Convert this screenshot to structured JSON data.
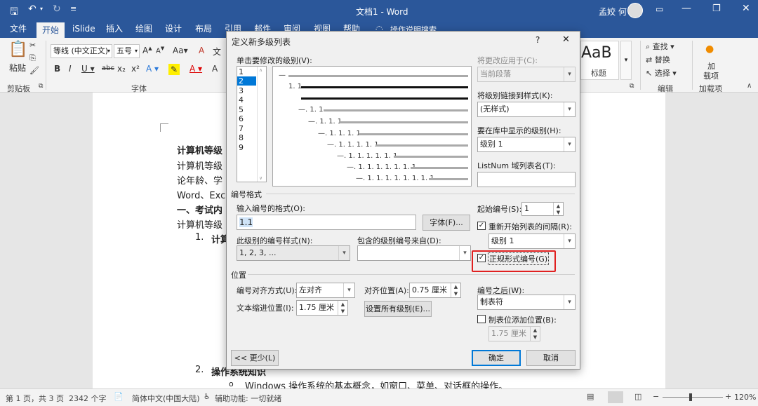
{
  "window": {
    "doc_title": "文档1 - Word",
    "user": "孟姣 何"
  },
  "tabs": [
    "文件",
    "开始",
    "iSlide",
    "插入",
    "绘图",
    "设计",
    "布局",
    "引用",
    "邮件",
    "审阅",
    "视图",
    "帮助"
  ],
  "tellme": "操作说明搜索",
  "ribbon": {
    "paste": "粘贴",
    "clipboard_group": "剪贴板",
    "font_name": "等线 (中文正文)",
    "font_size": "五号",
    "font_group": "字体",
    "style_sample": "AaB",
    "style_name": "标题",
    "find": "查找",
    "replace": "替换",
    "select": "选择",
    "edit_group": "编辑",
    "addin_label_1": "加",
    "addin_label_2": "载项",
    "addin_group": "加载项"
  },
  "document": {
    "lines": [
      "计算机等级",
      "计算机等级",
      "论年龄、学",
      "Word、Exce",
      "一、考试内",
      "计算机等级"
    ],
    "item1_num": "1.",
    "item1_text": "计算",
    "item2_num": "2.",
    "item2_text": "操作系统知识",
    "bullet_mark": "o",
    "bullet_text": "Windows 操作系统的基本概念，如窗口、菜单、对话框的操作。"
  },
  "status": {
    "page": "第 1 页，共 3 页",
    "words": "2342 个字",
    "lang": "简体中文(中国大陆)",
    "access": "辅助功能: 一切就绪",
    "zoom": "120%"
  },
  "dialog": {
    "title": "定义新多级列表",
    "help": "?",
    "close": "✕",
    "level_label": "单击要修改的级别(V):",
    "levels": [
      "1",
      "2",
      "3",
      "4",
      "5",
      "6",
      "7",
      "8",
      "9"
    ],
    "selected_level": "2",
    "preview_labels": [
      "1. 1",
      "—. 1. 1",
      "—. 1. 1. 1",
      "—. 1. 1. 1. 1",
      "—. 1. 1. 1. 1. 1",
      "—. 1. 1. 1. 1. 1. 1",
      "—. 1. 1. 1. 1. 1. 1. 1",
      "—. 1. 1. 1. 1. 1. 1. 1. 1"
    ],
    "apply_to_label": "将更改应用于(C):",
    "apply_to_value": "当前段落",
    "link_style_label": "将级别链接到样式(K):",
    "link_style_value": "(无样式)",
    "gallery_level_label": "要在库中显示的级别(H):",
    "gallery_level_value": "级别 1",
    "listnum_label": "ListNum 域列表名(T):",
    "listnum_value": "",
    "numfmt_section": "编号格式",
    "enter_format_label": "输入编号的格式(O):",
    "format_value": "1.1",
    "font_button": "字体(F)...",
    "start_at_label": "起始编号(S):",
    "start_at_value": "1",
    "restart_label": "重新开始列表的间隔(R):",
    "restart_value": "级别 1",
    "legal_label": "正规形式编号(G)",
    "style_label": "此级别的编号样式(N):",
    "style_value": "1, 2, 3, ...",
    "include_label": "包含的级别编号来自(D):",
    "include_value": "",
    "position_section": "位置",
    "align_label": "编号对齐方式(U):",
    "align_value": "左对齐",
    "aligned_at_label": "对齐位置(A):",
    "aligned_at_value": "0.75 厘米",
    "follow_label": "编号之后(W):",
    "follow_value": "制表符",
    "indent_label": "文本缩进位置(I):",
    "indent_value": "1.75 厘米",
    "set_all_button": "设置所有级别(E)...",
    "tab_add_label": "制表位添加位置(B):",
    "tab_add_value": "1.75 厘米",
    "less_button": "<< 更少(L)",
    "ok_button": "确定",
    "cancel_button": "取消"
  },
  "colors": {
    "accent": "#2b579a",
    "highlight": "#e02020",
    "selection": "#0078d7"
  }
}
